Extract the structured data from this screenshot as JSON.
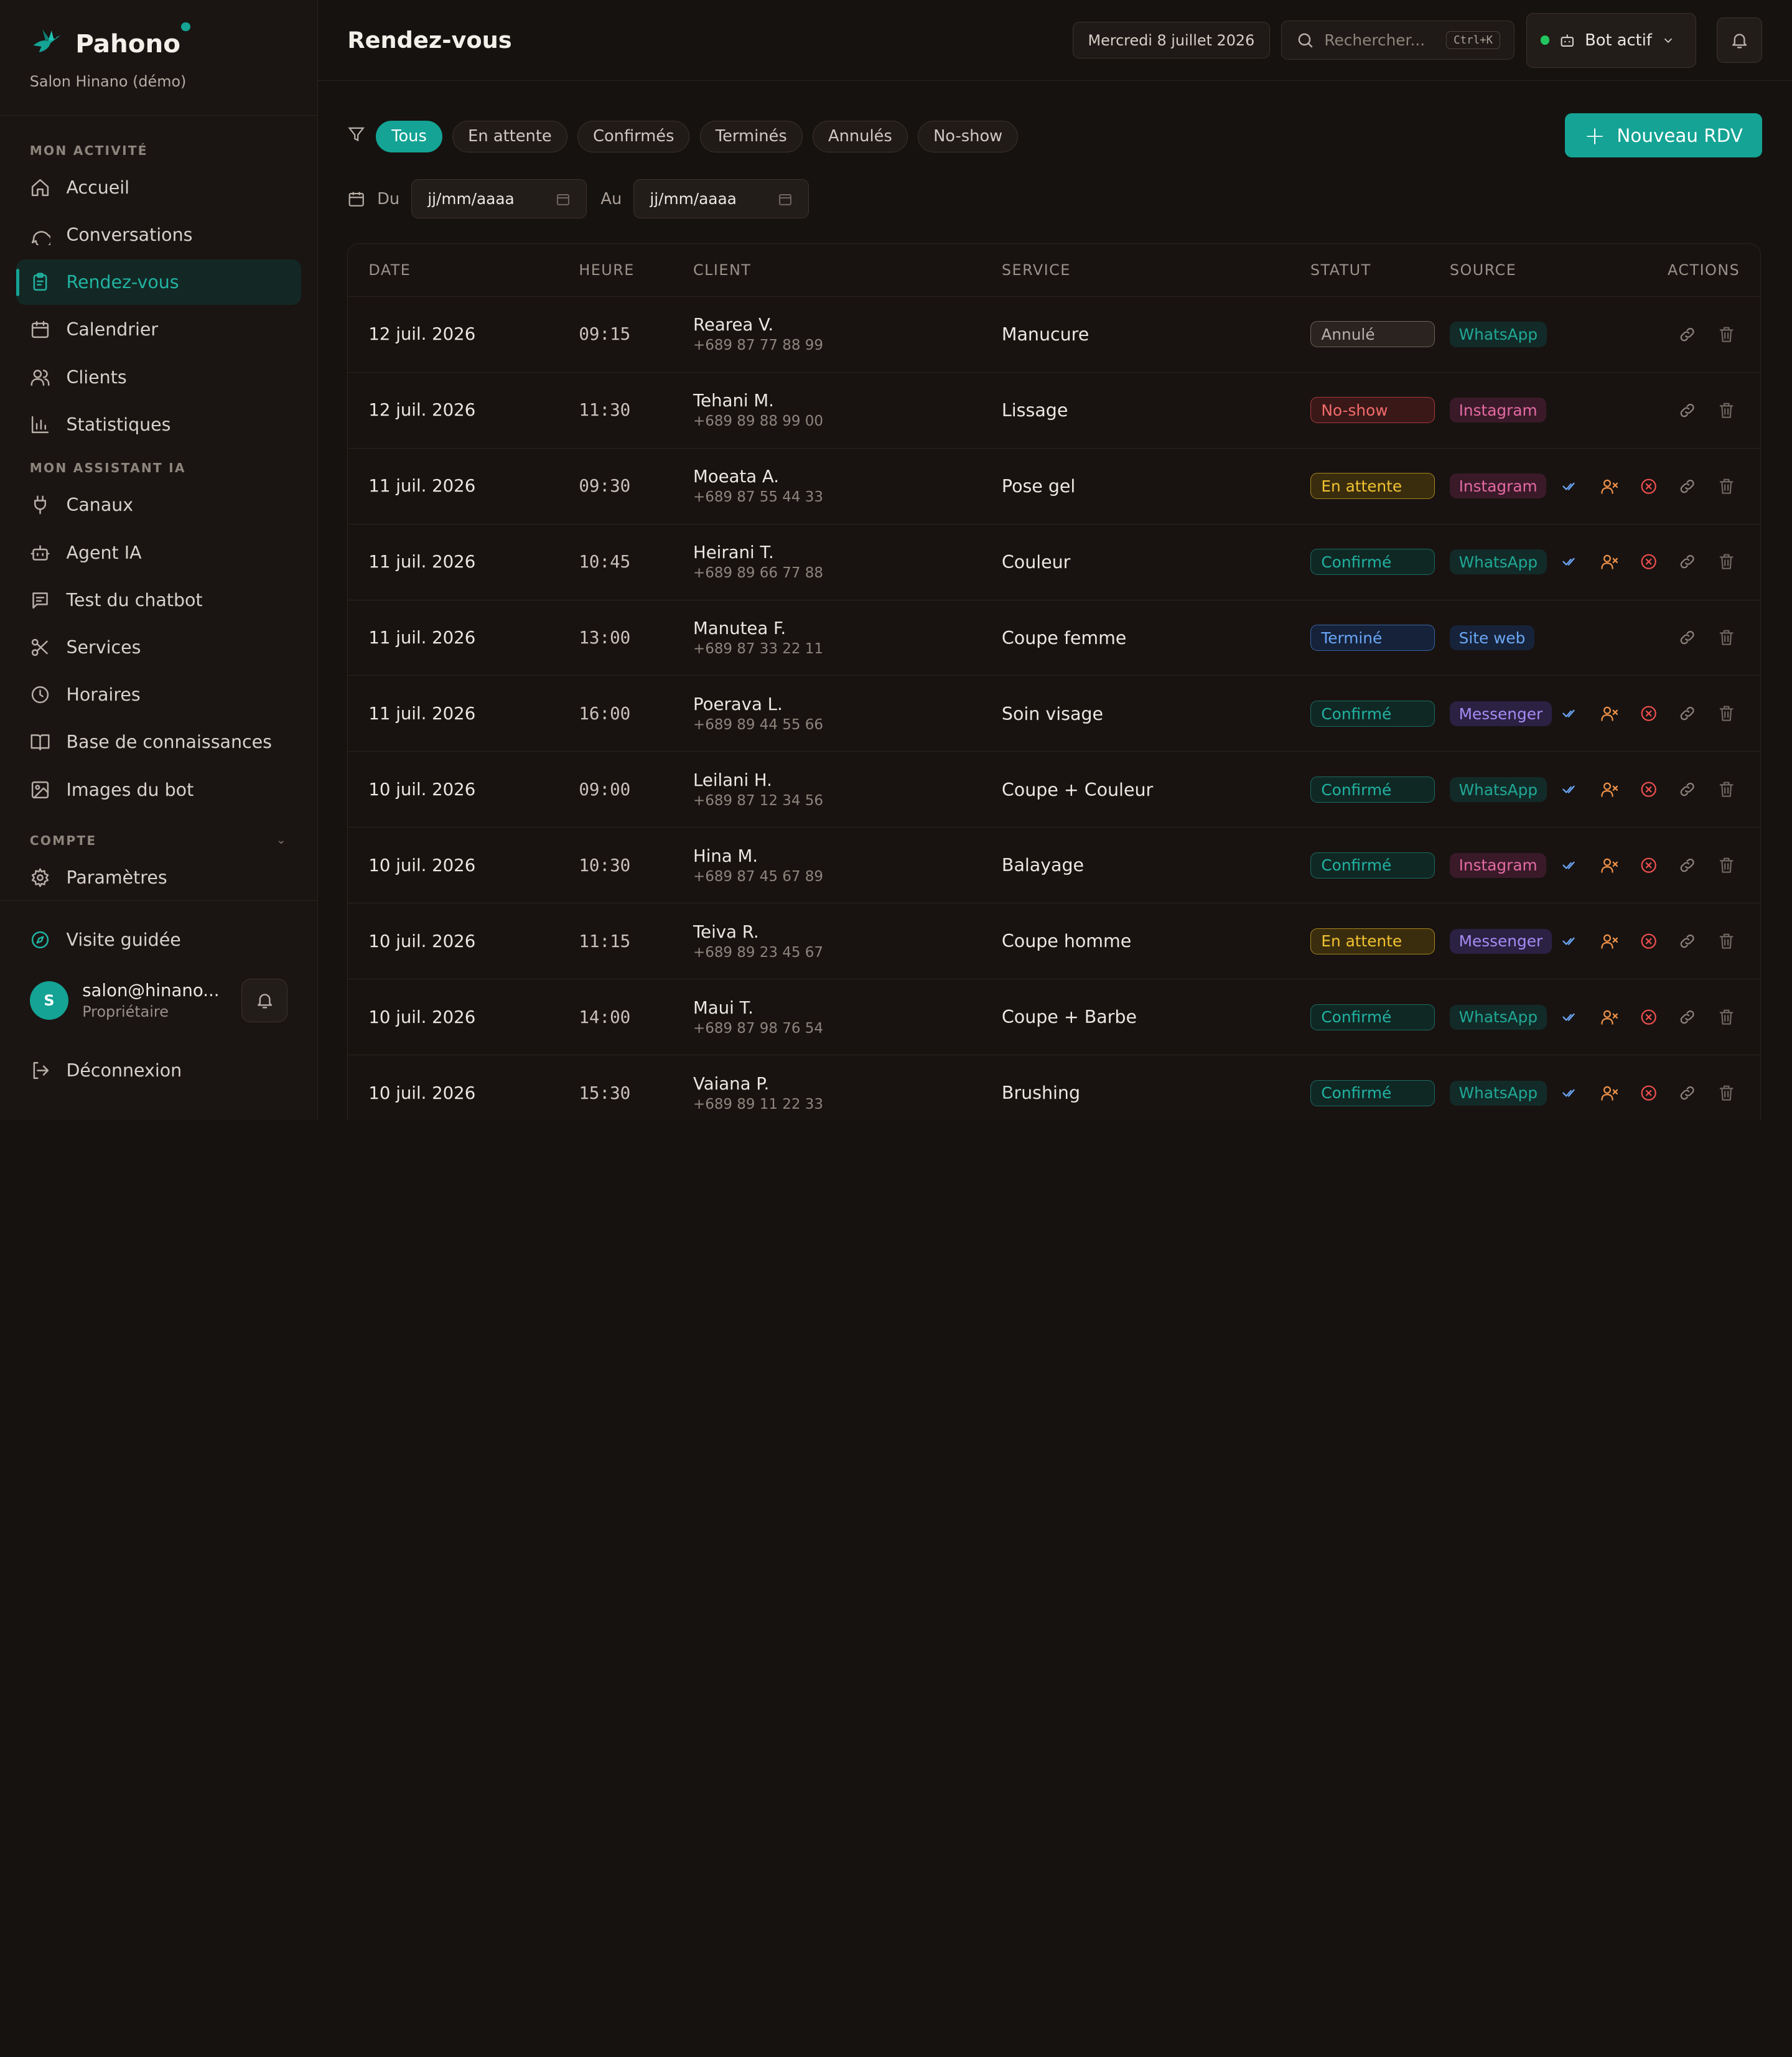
{
  "brand": {
    "name": "Pahono",
    "salon": "Salon Hinano (démo)"
  },
  "nav": {
    "section_activity": "MON ACTIVITÉ",
    "section_ai": "MON ASSISTANT IA",
    "section_account": "COMPTE",
    "items": [
      {
        "label": "Accueil",
        "icon": "home-icon"
      },
      {
        "label": "Conversations",
        "icon": "chat-icon"
      },
      {
        "label": "Rendez-vous",
        "icon": "clipboard-icon"
      },
      {
        "label": "Calendrier",
        "icon": "calendar-icon"
      },
      {
        "label": "Clients",
        "icon": "users-icon"
      },
      {
        "label": "Statistiques",
        "icon": "chart-icon"
      },
      {
        "label": "Canaux",
        "icon": "plug-icon"
      },
      {
        "label": "Agent IA",
        "icon": "bot-icon"
      },
      {
        "label": "Test du chatbot",
        "icon": "message-icon"
      },
      {
        "label": "Services",
        "icon": "scissors-icon"
      },
      {
        "label": "Horaires",
        "icon": "clock-icon"
      },
      {
        "label": "Base de connaissances",
        "icon": "book-icon"
      },
      {
        "label": "Images du bot",
        "icon": "image-icon"
      },
      {
        "label": "Paramètres",
        "icon": "gear-icon"
      }
    ],
    "tour": "Visite guidée",
    "logout": "Déconnexion"
  },
  "user": {
    "initial": "S",
    "email": "salon@hinano...",
    "role": "Propriétaire"
  },
  "header": {
    "title": "Rendez-vous",
    "date": "Mercredi 8 juillet 2026",
    "search_placeholder": "Rechercher...",
    "shortcut": "Ctrl+K",
    "bot_status": "Bot actif"
  },
  "filters": {
    "chips": [
      "Tous",
      "En attente",
      "Confirmés",
      "Terminés",
      "Annulés",
      "No-show"
    ],
    "active": "Tous",
    "new_button": "Nouveau RDV",
    "from_label": "Du",
    "to_label": "Au",
    "from_value": "jj/mm/aaaa",
    "to_value": "jj/mm/aaaa"
  },
  "table": {
    "columns": [
      "DATE",
      "HEURE",
      "CLIENT",
      "SERVICE",
      "STATUT",
      "SOURCE",
      "ACTIONS"
    ],
    "rows": [
      {
        "date": "12 juil. 2026",
        "time": "09:15",
        "name": "Rearea V.",
        "phone": "+689 87 77 88 99",
        "service": "Manucure",
        "status": "Annulé",
        "source": "WhatsApp",
        "full": false
      },
      {
        "date": "12 juil. 2026",
        "time": "11:30",
        "name": "Tehani M.",
        "phone": "+689 89 88 99 00",
        "service": "Lissage",
        "status": "No-show",
        "source": "Instagram",
        "full": false
      },
      {
        "date": "11 juil. 2026",
        "time": "09:30",
        "name": "Moeata A.",
        "phone": "+689 87 55 44 33",
        "service": "Pose gel",
        "status": "En attente",
        "source": "Instagram",
        "full": true
      },
      {
        "date": "11 juil. 2026",
        "time": "10:45",
        "name": "Heirani T.",
        "phone": "+689 89 66 77 88",
        "service": "Couleur",
        "status": "Confirmé",
        "source": "WhatsApp",
        "full": true
      },
      {
        "date": "11 juil. 2026",
        "time": "13:00",
        "name": "Manutea F.",
        "phone": "+689 87 33 22 11",
        "service": "Coupe femme",
        "status": "Terminé",
        "source": "Site web",
        "full": false
      },
      {
        "date": "11 juil. 2026",
        "time": "16:00",
        "name": "Poerava L.",
        "phone": "+689 89 44 55 66",
        "service": "Soin visage",
        "status": "Confirmé",
        "source": "Messenger",
        "full": true
      },
      {
        "date": "10 juil. 2026",
        "time": "09:00",
        "name": "Leilani H.",
        "phone": "+689 87 12 34 56",
        "service": "Coupe + Couleur",
        "status": "Confirmé",
        "source": "WhatsApp",
        "full": true
      },
      {
        "date": "10 juil. 2026",
        "time": "10:30",
        "name": "Hina M.",
        "phone": "+689 87 45 67 89",
        "service": "Balayage",
        "status": "Confirmé",
        "source": "Instagram",
        "full": true
      },
      {
        "date": "10 juil. 2026",
        "time": "11:15",
        "name": "Teiva R.",
        "phone": "+689 89 23 45 67",
        "service": "Coupe homme",
        "status": "En attente",
        "source": "Messenger",
        "full": true
      },
      {
        "date": "10 juil. 2026",
        "time": "14:00",
        "name": "Maui T.",
        "phone": "+689 87 98 76 54",
        "service": "Coupe + Barbe",
        "status": "Confirmé",
        "source": "WhatsApp",
        "full": true
      },
      {
        "date": "10 juil. 2026",
        "time": "15:30",
        "name": "Vaiana P.",
        "phone": "+689 89 11 22 33",
        "service": "Brushing",
        "status": "Confirmé",
        "source": "WhatsApp",
        "full": true
      }
    ]
  },
  "colors": {
    "accent": "#14a394",
    "status": {
      "Annulé": {
        "fg": "#b8b0a8",
        "bg": "#2a2320",
        "border": "#6a625b"
      },
      "No-show": {
        "fg": "#f26b6b",
        "bg": "#3a1818",
        "border": "#a83a3a"
      },
      "En attente": {
        "fg": "#f1c232",
        "bg": "#3a2d0e",
        "border": "#a8851f"
      },
      "Confirmé": {
        "fg": "#21b3a3",
        "bg": "#102824",
        "border": "#1b6b62"
      },
      "Terminé": {
        "fg": "#6aa6f5",
        "bg": "#15223a",
        "border": "#3a66a8"
      }
    },
    "source": {
      "WhatsApp": {
        "fg": "#20a896",
        "bg": "#122b28"
      },
      "Instagram": {
        "fg": "#e46aa2",
        "bg": "#3a1a29"
      },
      "Site web": {
        "fg": "#6aa6f5",
        "bg": "#17233a"
      },
      "Messenger": {
        "fg": "#a68bf2",
        "bg": "#2a2143"
      }
    }
  }
}
